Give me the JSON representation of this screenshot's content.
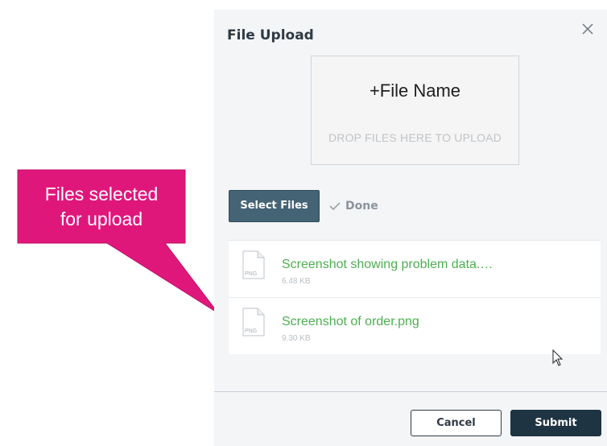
{
  "callout": {
    "line1": "Files selected",
    "line2": "for upload",
    "color": "#e0177b"
  },
  "dialog": {
    "title": "File Upload",
    "close_icon": "close-icon",
    "dropzone": {
      "name": "+File Name",
      "hint": "DROP FILES HERE TO UPLOAD"
    },
    "select_button": "Select Files",
    "done_label": "Done",
    "files": [
      {
        "name": "Screenshot showing problem data.…",
        "size": "6.48 KB",
        "type": "PNG"
      },
      {
        "name": "Screenshot of order.png",
        "size": "9.30 KB",
        "type": "PNG"
      }
    ],
    "cancel_button": "Cancel",
    "submit_button": "Submit"
  },
  "colors": {
    "file_name": "#4caf50",
    "select_button_bg": "#446375",
    "submit_bg": "#1f3443"
  }
}
